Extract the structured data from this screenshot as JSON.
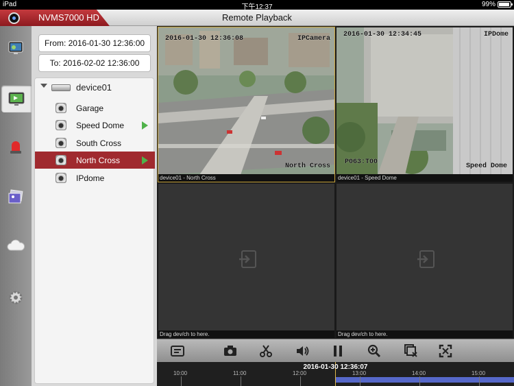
{
  "status_bar": {
    "device": "iPad",
    "time": "下午12:37",
    "battery": "99%"
  },
  "header": {
    "app_name": "NVMS7000 HD",
    "title": "Remote Playback"
  },
  "dates": {
    "from": "From: 2016-01-30 12:36:00",
    "to": "To: 2016-02-02 12:36:00"
  },
  "tree": {
    "device": "device01",
    "channels": [
      {
        "label": "Garage",
        "playing": false,
        "selected": false
      },
      {
        "label": "Speed Dome",
        "playing": true,
        "selected": false
      },
      {
        "label": "South Cross",
        "playing": false,
        "selected": false
      },
      {
        "label": "North Cross",
        "playing": true,
        "selected": true
      },
      {
        "label": "IPdome",
        "playing": false,
        "selected": false
      }
    ]
  },
  "grid": {
    "cells": [
      {
        "caption": "device01 - North Cross",
        "osd_time": "2016-01-30 12:36:08",
        "osd_name": "IPCamera",
        "osd_bottom": "North Cross"
      },
      {
        "caption": "device01 - Speed Dome",
        "osd_time": "2016-01-30 12:34:45",
        "osd_name": "IPDome",
        "osd_left": "P063:T00",
        "osd_bottom": "Speed Dome"
      },
      {
        "caption": "Drag dev/ch to here."
      },
      {
        "caption": "Drag dev/ch to here."
      }
    ]
  },
  "toolbar": {
    "icons": [
      "playback-list-icon",
      "camera-snapshot-icon",
      "scissors-clip-icon",
      "speaker-volume-icon",
      "pause-icon",
      "zoom-in-icon",
      "close-all-icon",
      "fullscreen-icon"
    ]
  },
  "timeline": {
    "current": "2016-01-30 12:36:07",
    "ticks": [
      "10:00",
      "11:00",
      "12:00",
      "13:00",
      "14:00",
      "15:00"
    ]
  },
  "colors": {
    "brand": "#a02a2f",
    "play": "#4fb24a",
    "record_bar": "#5668c9",
    "active_border": "#c9a43a"
  }
}
